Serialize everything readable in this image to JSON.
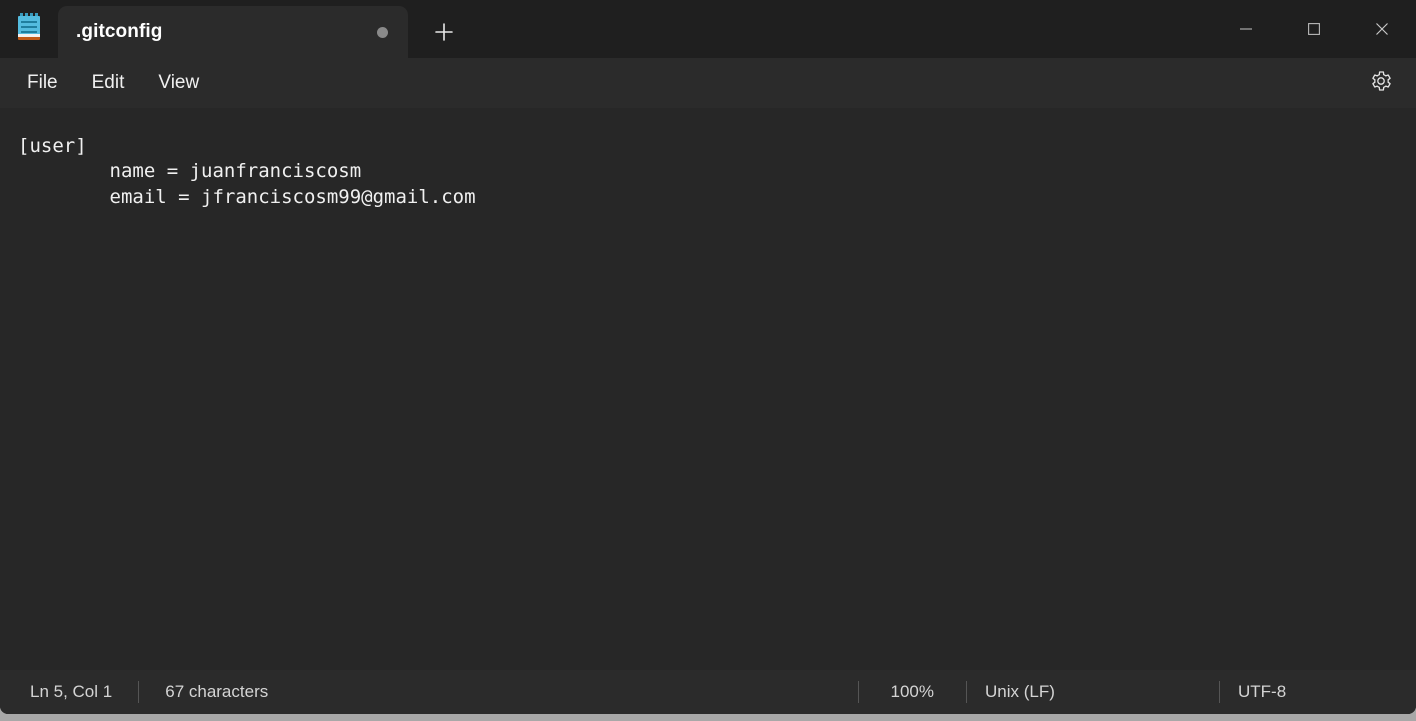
{
  "window": {
    "app_icon": "notepad-icon",
    "controls": {
      "minimize": "minimize-icon",
      "maximize": "maximize-icon",
      "close": "close-icon"
    }
  },
  "tabs": {
    "items": [
      {
        "title": ".gitconfig",
        "modified": true,
        "active": true
      }
    ],
    "new_tab_label": "+"
  },
  "menubar": {
    "items": [
      {
        "label": "File"
      },
      {
        "label": "Edit"
      },
      {
        "label": "View"
      }
    ],
    "settings_icon": "gear-icon"
  },
  "editor": {
    "content": "[user]\n        name = juanfranciscosm\n        email = jfranciscosm99@gmail.com",
    "lines": [
      "[user]",
      "        name = juanfranciscosm",
      "        email = jfranciscosm99@gmail.com"
    ]
  },
  "statusbar": {
    "cursor_position": "Ln 5, Col 1",
    "character_count": "67 characters",
    "zoom": "100%",
    "line_ending": "Unix (LF)",
    "encoding": "UTF-8"
  },
  "colors": {
    "titlebar_bg": "#1f1f1f",
    "tab_bg": "#2b2b2b",
    "menubar_bg": "#2b2b2b",
    "editor_bg": "#272727",
    "statusbar_bg": "#2b2b2b",
    "text": "#f0f0f0",
    "icon_accent": "#54bcdf",
    "icon_base": "#c05a18",
    "modified_dot": "#8a8a8a"
  }
}
